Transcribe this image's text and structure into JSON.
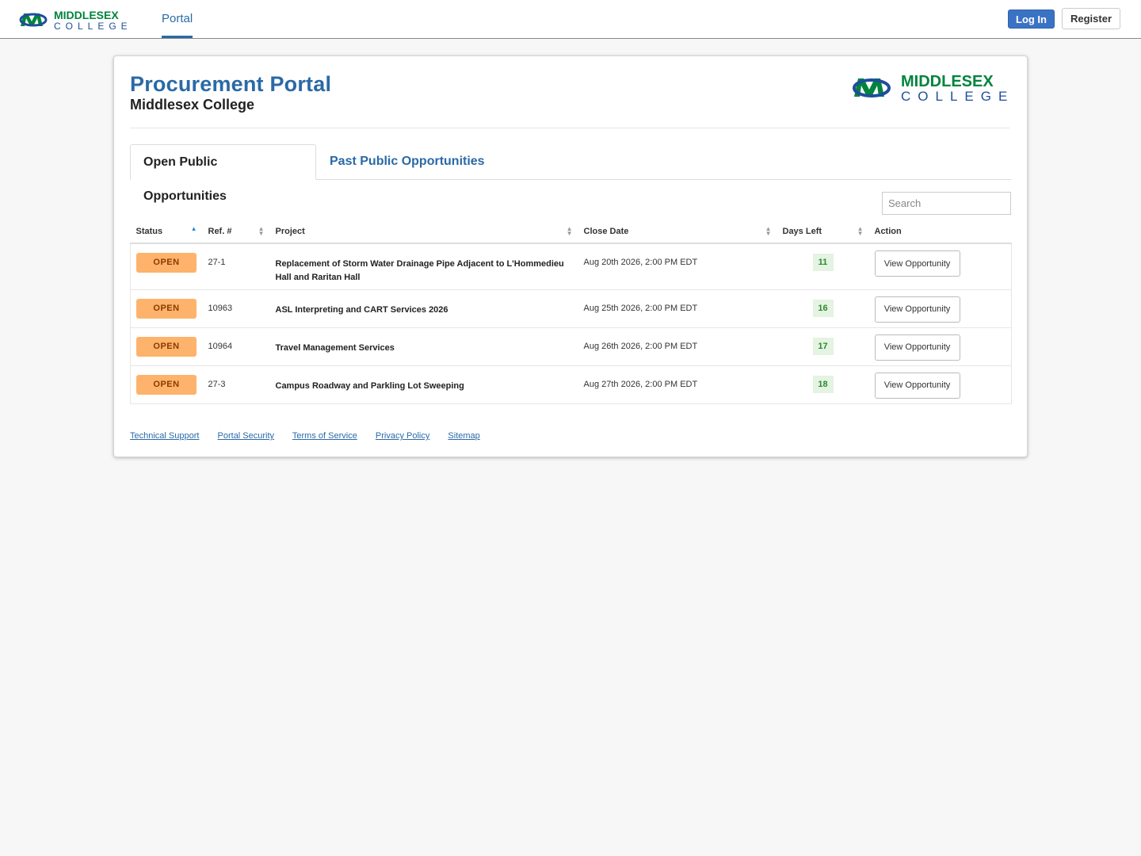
{
  "brand": {
    "name": "MIDDLESEX",
    "sub": "COLLEGE",
    "primary_color": "#00843d",
    "secondary_color": "#1f4e9a"
  },
  "nav": {
    "portal_label": "Portal",
    "login_label": "Log In",
    "register_label": "Register"
  },
  "card": {
    "title": "Procurement Portal",
    "subtitle": "Middlesex College"
  },
  "tabs": [
    {
      "label": "Open Public Opportunities",
      "active": true
    },
    {
      "label": "Past Public Opportunities",
      "active": false
    }
  ],
  "search": {
    "placeholder": "Search",
    "value": ""
  },
  "table": {
    "headers": [
      "Status",
      "Ref. #",
      "Project",
      "Close Date",
      "Days Left",
      "Action"
    ],
    "rows": [
      {
        "status": "OPEN",
        "ref": "27-1",
        "project": "Replacement of Storm Water Drainage Pipe Adjacent to L'Hommedieu Hall and Raritan Hall",
        "close_date": "Aug 20th 2026, 2:00 PM EDT",
        "days_left": "11",
        "action": "View Opportunity"
      },
      {
        "status": "OPEN",
        "ref": "10963",
        "project": "ASL Interpreting and CART Services 2026",
        "close_date": "Aug 25th 2026, 2:00 PM EDT",
        "days_left": "16",
        "action": "View Opportunity"
      },
      {
        "status": "OPEN",
        "ref": "10964",
        "project": "Travel Management Services",
        "close_date": "Aug 26th 2026, 2:00 PM EDT",
        "days_left": "17",
        "action": "View Opportunity"
      },
      {
        "status": "OPEN",
        "ref": "27-3",
        "project": "Campus Roadway and Parkling Lot Sweeping",
        "close_date": "Aug 27th 2026, 2:00 PM EDT",
        "days_left": "18",
        "action": "View Opportunity"
      }
    ]
  },
  "footer": {
    "links": [
      "Technical Support",
      "Portal Security",
      "Terms of Service",
      "Privacy Policy",
      "Sitemap"
    ]
  },
  "colors": {
    "link_blue": "#2a6aa6",
    "login_blue": "#3b73c4",
    "status_open": "#fdb36b",
    "days_badge_bg": "#e4f3e2"
  }
}
